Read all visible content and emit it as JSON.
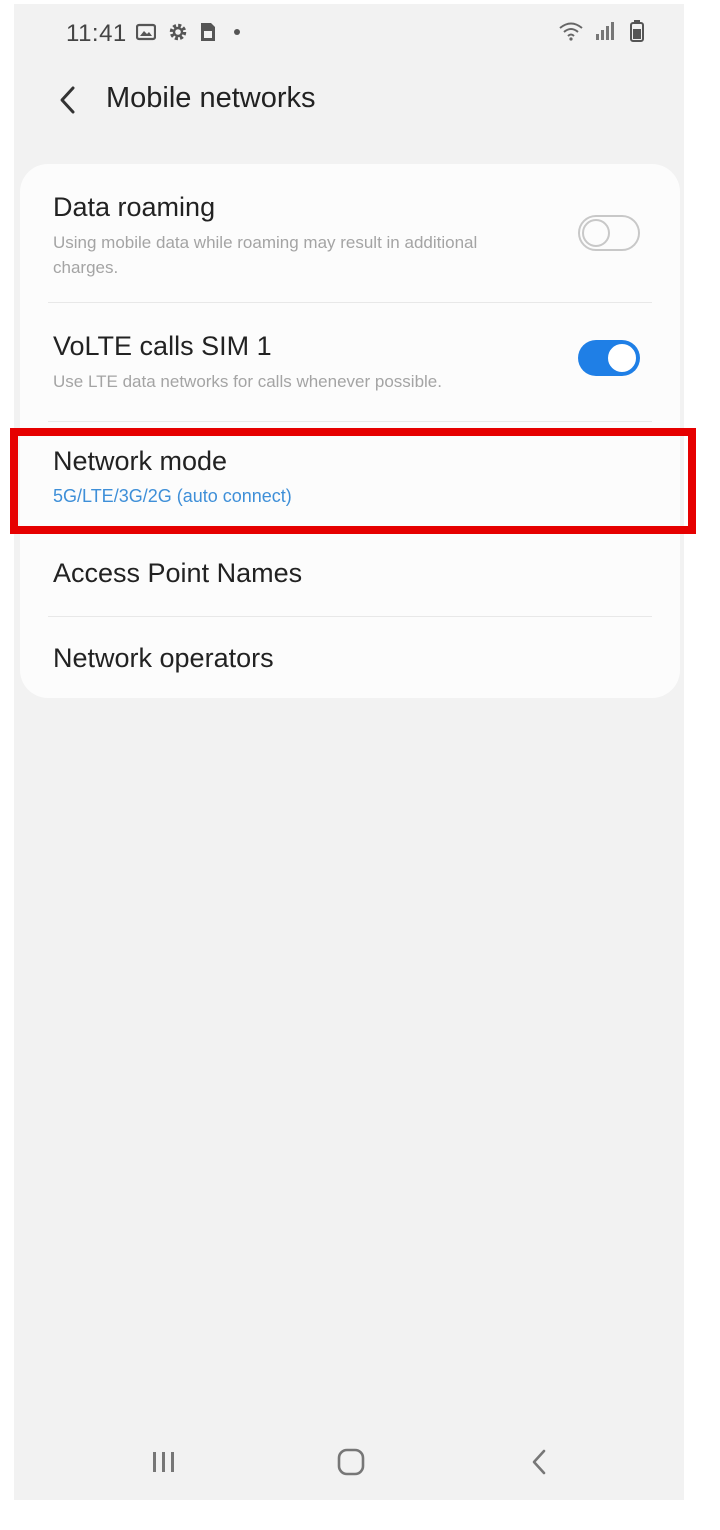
{
  "status_bar": {
    "time": "11:41",
    "left_icons": [
      "image-icon",
      "gear-icon",
      "sim-card-icon",
      "notification-dot-icon"
    ],
    "right_icons": [
      "wifi-icon",
      "signal-icon",
      "battery-icon"
    ]
  },
  "header": {
    "title": "Mobile networks",
    "back_icon": "chevron-left-icon"
  },
  "settings": {
    "data_roaming": {
      "title": "Data roaming",
      "subtitle": "Using mobile data while roaming may result in additional charges.",
      "enabled": false
    },
    "volte": {
      "title": "VoLTE calls SIM 1",
      "subtitle": "Use LTE data networks for calls whenever possible.",
      "enabled": true
    },
    "network_mode": {
      "title": "Network mode",
      "value": "5G/LTE/3G/2G (auto connect)"
    },
    "access_point_names": {
      "title": "Access Point Names"
    },
    "network_operators": {
      "title": "Network operators"
    }
  },
  "nav_bar": {
    "buttons": [
      "recent-apps-icon",
      "home-icon",
      "back-icon"
    ]
  },
  "colors": {
    "accent": "#1f7fe6",
    "accent_text": "#3e8fd8",
    "highlight": "#e60000",
    "background": "#f2f2f2",
    "card": "#fcfcfc"
  }
}
